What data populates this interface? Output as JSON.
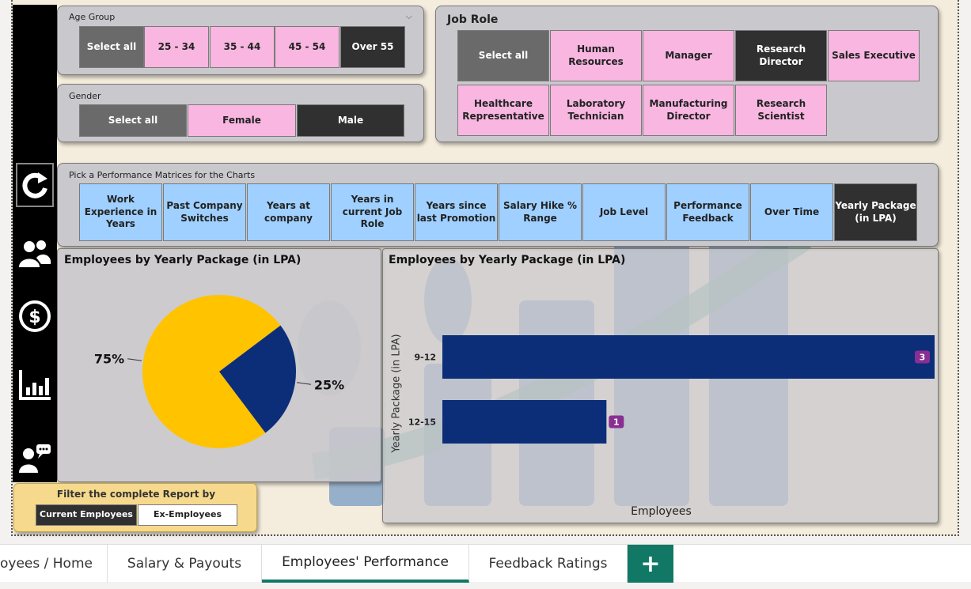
{
  "age_group": {
    "title": "Age Group",
    "options": [
      "Select all",
      "25 - 34",
      "35 - 44",
      "45 - 54",
      "Over 55"
    ]
  },
  "gender": {
    "title": "Gender",
    "options": [
      "Select all",
      "Female",
      "Male"
    ]
  },
  "job_role": {
    "title": "Job Role",
    "options": [
      "Select all",
      "Human Resources",
      "Manager",
      "Research Director",
      "Sales Executive",
      "Healthcare Representative",
      "Laboratory Technician",
      "Manufacturing Director",
      "Research Scientist"
    ]
  },
  "metrics": {
    "title": "Pick a Performance Matrices for the Charts",
    "options": [
      "Work Experience in Years",
      "Past Company Switches",
      "Years at company",
      "Years in current Job Role",
      "Years since last Promotion",
      "Salary Hike % Range",
      "Job Level",
      "Performance Feedback",
      "Over Time",
      "Yearly Package (in LPA)"
    ]
  },
  "filter": {
    "title": "Filter the complete Report by",
    "current": "Current Employees",
    "ex": "Ex-Employees"
  },
  "chart_data": [
    {
      "type": "pie",
      "title": "Employees by Yearly Package (in LPA)",
      "slices": [
        {
          "label": "75%",
          "value": 75,
          "color": "#ffc300"
        },
        {
          "label": "25%",
          "value": 25,
          "color": "#0c2e78"
        }
      ]
    },
    {
      "type": "bar",
      "orientation": "horizontal",
      "title": "Employees by Yearly Package (in LPA)",
      "categories": [
        "9-12",
        "12-15"
      ],
      "values": [
        3,
        1
      ],
      "xlabel": "Employees",
      "ylabel": "Yearly Package (in LPA)",
      "bar_color": "#0c2e78",
      "label_color": "#8a2e93"
    }
  ],
  "tabs": [
    "oyees / Home",
    "Salary & Payouts",
    "Employees' Performance",
    "Feedback Ratings"
  ],
  "add_tab": "+"
}
